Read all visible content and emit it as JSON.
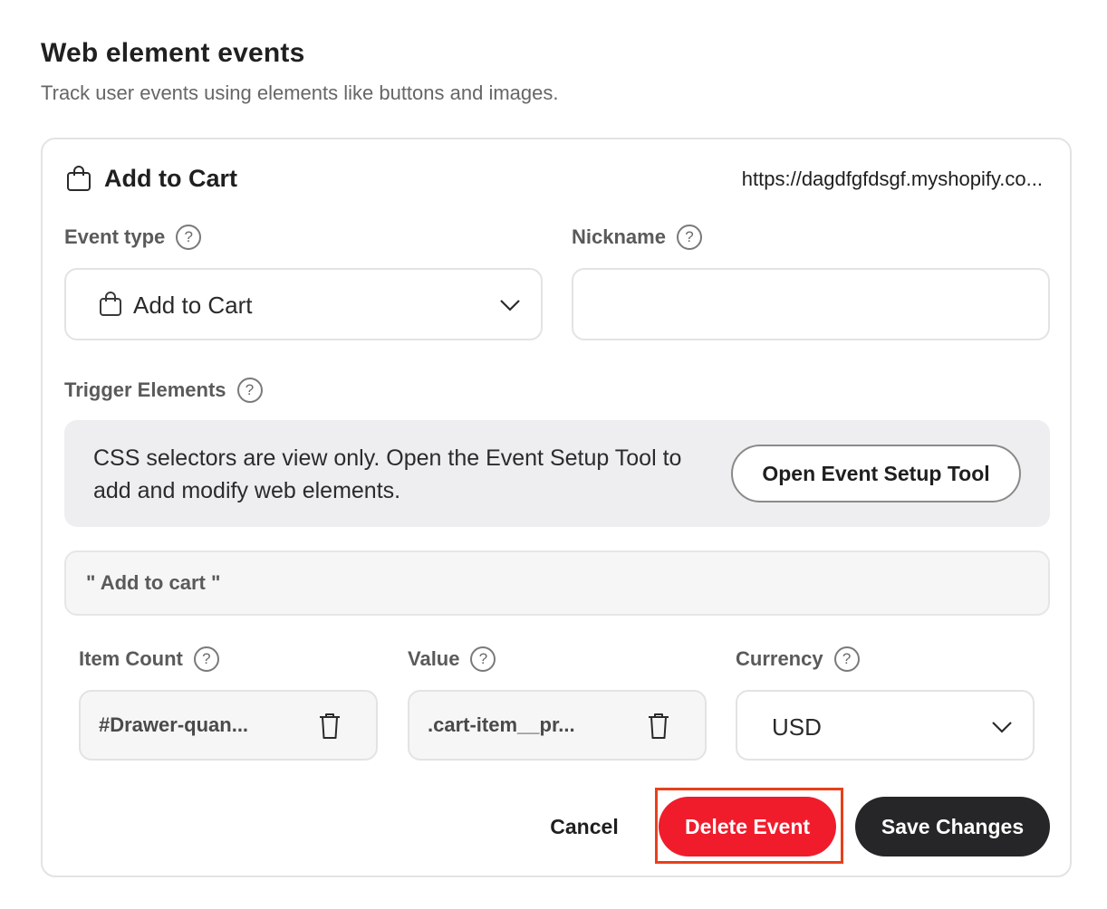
{
  "header": {
    "title": "Web element events",
    "subtitle": "Track user events using elements like buttons and images."
  },
  "card": {
    "icon": "shopping-bag-icon",
    "title": "Add to Cart",
    "url": "https://dagdfgfdsgf.myshopify.co..."
  },
  "fields": {
    "event_type": {
      "label": "Event type",
      "value": "Add to Cart",
      "icon": "shopping-bag-icon"
    },
    "nickname": {
      "label": "Nickname",
      "value": ""
    },
    "trigger": {
      "label": "Trigger Elements"
    },
    "item_count": {
      "label": "Item Count",
      "value": "#Drawer-quan..."
    },
    "value": {
      "label": "Value",
      "value": ".cart-item__pr..."
    },
    "currency": {
      "label": "Currency",
      "value": "USD"
    }
  },
  "help_glyph": "?",
  "info_panel": {
    "text": "CSS selectors are view only. Open the Event Setup Tool to add and modify web elements.",
    "button_label": "Open Event Setup Tool"
  },
  "selector": {
    "text": "\" Add to cart \""
  },
  "actions": {
    "cancel": "Cancel",
    "delete": "Delete Event",
    "save": "Save Changes"
  },
  "colors": {
    "delete": "#f01c2c",
    "highlight": "#e8401a",
    "save": "#262628"
  }
}
